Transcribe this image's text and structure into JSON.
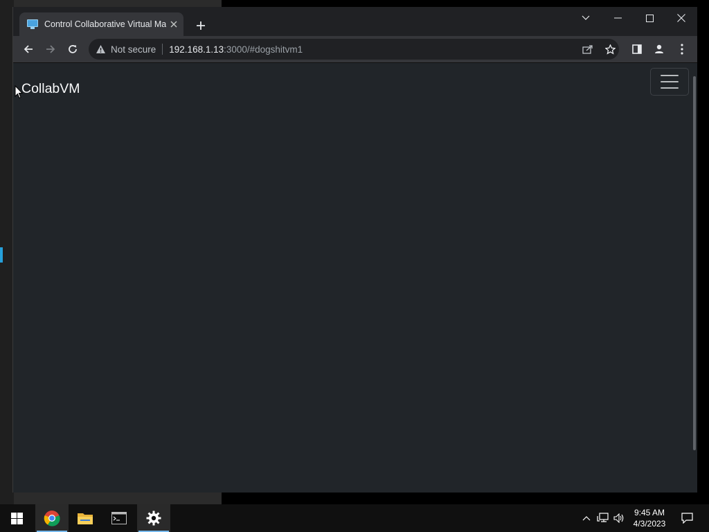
{
  "browser": {
    "tab": {
      "title": "Control Collaborative Virtual Machine",
      "favicon": "computer-monitor-icon",
      "close_glyph": "✕"
    },
    "new_tab_glyph": "+",
    "window_controls": [
      "chevron-down-icon",
      "minimize-icon",
      "maximize-icon",
      "close-icon"
    ],
    "toolbar": {
      "back": "back-arrow-icon",
      "forward": "forward-arrow-icon",
      "reload": "reload-icon",
      "security_label": "Not secure",
      "url_host": "192.168.1.13",
      "url_rest": ":3000/#dogshitvm1",
      "right_icons": [
        "share-icon",
        "bookmark-star-icon",
        "side-panel-icon",
        "profile-icon",
        "menu-kebab-icon"
      ]
    }
  },
  "page": {
    "brand": "CollabVM",
    "background_color": "#212529",
    "navbar_toggler": "hamburger-menu-icon"
  },
  "taskbar": {
    "apps": [
      "windows-start-icon",
      "chrome-icon",
      "file-explorer-icon",
      "terminal-icon",
      "settings-gear-icon"
    ],
    "tray_icons": [
      "chevron-up-icon",
      "network-icon",
      "volume-icon",
      "notification-icon"
    ],
    "time": "9:45 AM",
    "date": "4/3/2023",
    "accent_color": "#76b9ed"
  }
}
